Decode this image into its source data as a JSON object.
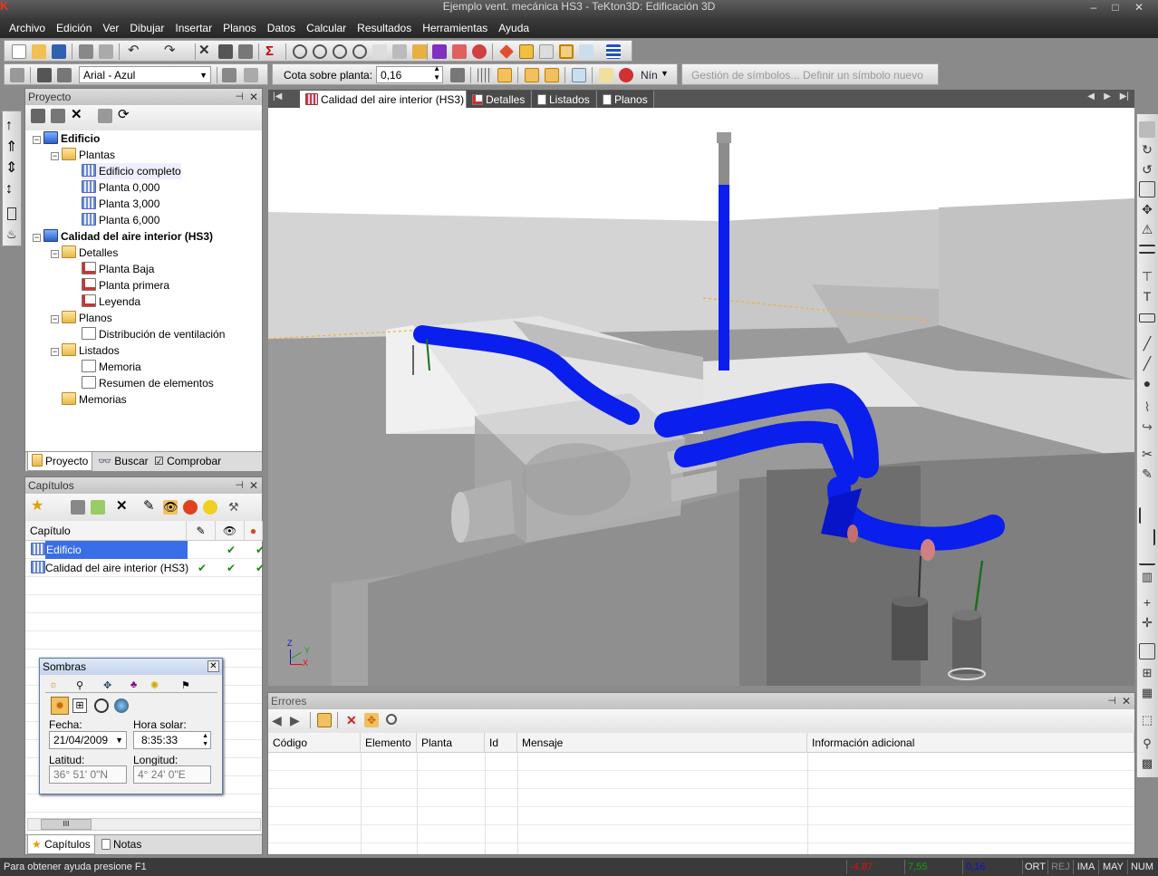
{
  "window": {
    "title": "Ejemplo vent. mecánica HS3 - TeKton3D: Edificación 3D"
  },
  "menu": [
    "Archivo",
    "Edición",
    "Ver",
    "Dibujar",
    "Insertar",
    "Planos",
    "Datos",
    "Calcular",
    "Resultados",
    "Herramientas",
    "Ayuda"
  ],
  "toolbar2": {
    "font_value": "Arial - Azul",
    "cota_label": "Cota sobre planta:",
    "cota_value": "0,16",
    "nin_label": "Nín",
    "symbols_manage": "Gestión de símbolos...",
    "symbols_define": "Definir un símbolo nuevo"
  },
  "proyecto": {
    "title": "Proyecto",
    "tree": [
      {
        "label": "Edificio",
        "bold": true
      },
      {
        "label": "Plantas"
      },
      {
        "label": "Edificio completo"
      },
      {
        "label": "Planta 0,000"
      },
      {
        "label": "Planta 3,000"
      },
      {
        "label": "Planta 6,000"
      },
      {
        "label": "Calidad del aire interior (HS3)",
        "bold": true
      },
      {
        "label": "Detalles"
      },
      {
        "label": "Planta Baja"
      },
      {
        "label": "Planta primera"
      },
      {
        "label": "Leyenda"
      },
      {
        "label": "Planos"
      },
      {
        "label": "Distribución de ventilación"
      },
      {
        "label": "Listados"
      },
      {
        "label": "Memoria"
      },
      {
        "label": "Resumen de elementos"
      },
      {
        "label": "Memorias"
      }
    ],
    "tabs": [
      "Proyecto",
      "Buscar",
      "Comprobar"
    ]
  },
  "capitulos": {
    "title": "Capítulos",
    "column": "Capítulo",
    "rows": [
      {
        "name": "Edificio",
        "checks": [
          "",
          "✔",
          "✔"
        ]
      },
      {
        "name": "Calidad del aire interior (HS3)",
        "checks": [
          "✔",
          "✔",
          "✔"
        ]
      }
    ],
    "tabs": [
      "Capítulos",
      "Notas"
    ],
    "scroll_grip": "III"
  },
  "sombras": {
    "title": "Sombras",
    "fecha_label": "Fecha:",
    "fecha_value": "21/04/2009",
    "hora_label": "Hora solar:",
    "hora_value": "8:35:33",
    "latitud_label": "Latitud:",
    "latitud_value": "36° 51' 0\"N",
    "longitud_label": "Longitud:",
    "longitud_value": "4° 24' 0\"E"
  },
  "doc_tabs": [
    "Calidad del aire interior (HS3)",
    "Detalles",
    "Listados",
    "Planos"
  ],
  "axes": {
    "z": "Z",
    "y": "Y",
    "x": "X"
  },
  "errores": {
    "title": "Errores",
    "columns": [
      "Código",
      "Elemento",
      "Planta",
      "Id",
      "Mensaje",
      "Información adicional"
    ]
  },
  "status": {
    "help": "Para obtener ayuda presione F1",
    "x": "-4,87",
    "y": "7,55",
    "z": "0,16",
    "flags": [
      "ORT",
      "REJ",
      "IMA",
      "MAY",
      "NUM"
    ]
  },
  "colors": {
    "duct": "#0a1eee",
    "accent_x": "#e01010",
    "accent_y": "#10a010",
    "accent_z": "#1010d0"
  }
}
